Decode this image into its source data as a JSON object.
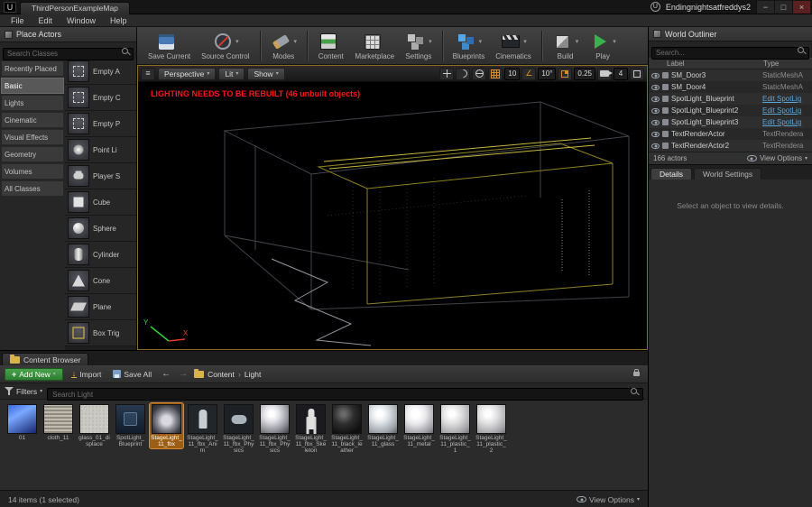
{
  "icons": {
    "caret": "▾",
    "minimize": "−",
    "maximize": "□",
    "close": "×",
    "back": "←",
    "forward": "→",
    "breadcrumb_sep": "›",
    "hamburger": "≡",
    "angle": "∠",
    "plus": "+",
    "logo_letter": "U",
    "import_arrow": "↓"
  },
  "window": {
    "tab_title": "ThirdPersonExampleMap",
    "app_title": "Endingnightsatfreddys2",
    "menu": [
      "File",
      "Edit",
      "Window",
      "Help"
    ]
  },
  "place_actors": {
    "title": "Place Actors",
    "search_placeholder": "Search Classes",
    "selected_category": "Basic",
    "categories": [
      "Recently Placed",
      "Basic",
      "Lights",
      "Cinematic",
      "Visual Effects",
      "Geometry",
      "Volumes",
      "All Classes"
    ],
    "items": [
      {
        "label": "Empty A",
        "icon": "empty"
      },
      {
        "label": "Empty C",
        "icon": "empty"
      },
      {
        "label": "Empty P",
        "icon": "empty"
      },
      {
        "label": "Point Li",
        "icon": "point-light"
      },
      {
        "label": "Player S",
        "icon": "player-start"
      },
      {
        "label": "Cube",
        "icon": "cube"
      },
      {
        "label": "Sphere",
        "icon": "sphere"
      },
      {
        "label": "Cylinder",
        "icon": "cylinder"
      },
      {
        "label": "Cone",
        "icon": "cone"
      },
      {
        "label": "Plane",
        "icon": "plane"
      },
      {
        "label": "Box Trig",
        "icon": "box-trigger"
      }
    ]
  },
  "toolbar": {
    "buttons": [
      {
        "label": "Save Current",
        "icon": "save",
        "dropdown": false,
        "sep_after": false
      },
      {
        "label": "Source Control",
        "icon": "source",
        "dropdown": true,
        "sep_after": true
      },
      {
        "label": "Modes",
        "icon": "modes",
        "dropdown": true,
        "sep_after": true
      },
      {
        "label": "Content",
        "icon": "content",
        "dropdown": false,
        "sep_after": false
      },
      {
        "label": "Marketplace",
        "icon": "marketplace",
        "dropdown": false,
        "sep_after": false
      },
      {
        "label": "Settings",
        "icon": "settings",
        "dropdown": true,
        "sep_after": true
      },
      {
        "label": "Blueprints",
        "icon": "blueprints",
        "dropdown": true,
        "sep_after": false
      },
      {
        "label": "Cinematics",
        "icon": "cinematics",
        "dropdown": true,
        "sep_after": true
      },
      {
        "label": "Build",
        "icon": "build",
        "dropdown": true,
        "sep_after": false
      },
      {
        "label": "Play",
        "icon": "play",
        "dropdown": true,
        "sep_after": false
      }
    ]
  },
  "viewport": {
    "camera_mode": "Perspective",
    "view_mode": "Lit",
    "show_label": "Show",
    "warning": "LIGHTING NEEDS TO BE REBUILT (46 unbuilt objects)",
    "grid_snap": "10",
    "rotation_snap": "10°",
    "scale_snap": "0.25",
    "camera_speed": "4",
    "axis_x": "X",
    "axis_y": "Y"
  },
  "world_outliner": {
    "title": "World Outliner",
    "search_placeholder": "Search...",
    "columns": [
      "Label",
      "Type"
    ],
    "rows": [
      {
        "label": "SM_Door3",
        "type": "StaticMeshA",
        "link": false
      },
      {
        "label": "SM_Door4",
        "type": "StaticMeshA",
        "link": false
      },
      {
        "label": "SpotLight_Blueprint",
        "type": "Edit SpotLig",
        "link": true
      },
      {
        "label": "SpotLight_Blueprint2",
        "type": "Edit SpotLig",
        "link": true
      },
      {
        "label": "SpotLight_Blueprint3",
        "type": "Edit SpotLig",
        "link": true
      },
      {
        "label": "TextRenderActor",
        "type": "TextRendera",
        "link": false
      },
      {
        "label": "TextRenderActor2",
        "type": "TextRendera",
        "link": false
      }
    ],
    "actor_count": "166 actors",
    "view_options_label": "View Options"
  },
  "details": {
    "tabs": [
      "Details",
      "World Settings"
    ],
    "active_tab": "Details",
    "empty_message": "Select an object to view details."
  },
  "content_browser": {
    "tab_title": "Content Browser",
    "add_new_label": "Add New",
    "import_label": "Import",
    "save_all_label": "Save All",
    "breadcrumb": [
      "Content",
      "Light"
    ],
    "filters_label": "Filters",
    "search_placeholder": "Search Light",
    "assets": [
      {
        "name": "01",
        "thumb": "tex-blue",
        "selected": false
      },
      {
        "name": "cloth_11",
        "thumb": "tex-cloth",
        "selected": false
      },
      {
        "name": "glass_01_displace",
        "thumb": "tex-noise",
        "selected": false
      },
      {
        "name": "SpotLight_Blueprint",
        "thumb": "blueprint",
        "selected": false
      },
      {
        "name": "StageLight_11_fbx",
        "thumb": "mesh",
        "selected": true
      },
      {
        "name": "StageLight_11_fbx_Anim",
        "thumb": "anim",
        "selected": false
      },
      {
        "name": "StageLight_11_fbx_Physics",
        "thumb": "physics",
        "selected": false
      },
      {
        "name": "StageLight_11_fbx_Physics",
        "thumb": "ball-white",
        "selected": false
      },
      {
        "name": "StageLight_11_fbx_Skeleton",
        "thumb": "skeleton",
        "selected": false
      },
      {
        "name": "StageLight_11_black_leather",
        "thumb": "ball-dark",
        "selected": false
      },
      {
        "name": "StageLight_11_glass",
        "thumb": "ball-glass",
        "selected": false
      },
      {
        "name": "StageLight_11_metal",
        "thumb": "ball-metal",
        "selected": false
      },
      {
        "name": "StageLight_11_plastic_1",
        "thumb": "ball-plastic",
        "selected": false
      },
      {
        "name": "StageLight_11_plastic_2",
        "thumb": "ball-plastic",
        "selected": false
      }
    ],
    "status": "14 items (1 selected)",
    "view_options_label": "View Options"
  },
  "colors": {
    "selection_orange": "#c17c24",
    "warning_red": "#ff1515",
    "link_blue": "#58a6dc",
    "add_new_green": "#3c8f3c",
    "viewport_border": "#8a6d1f"
  }
}
